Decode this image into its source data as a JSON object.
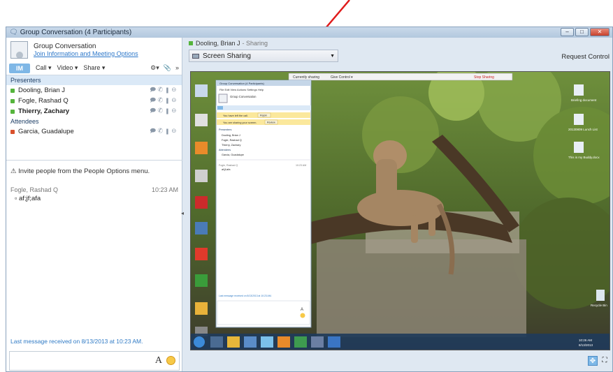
{
  "window": {
    "title": "Group Conversation (4 Participants)",
    "title_icon": "group-chat-icon"
  },
  "conversation": {
    "title": "Group Conversation",
    "join_link": "Join Information and Meeting Options"
  },
  "modebar": {
    "im": "IM",
    "call": "Call ▾",
    "video": "Video ▾",
    "share": "Share ▾"
  },
  "roster": {
    "presenters_heading": "Presenters",
    "presenters": [
      {
        "name": "Dooling, Brian J",
        "status_color": "#55b43c"
      },
      {
        "name": "Fogle, Rashad Q",
        "status_color": "#55b43c"
      },
      {
        "name": "Thierry, Zachary",
        "status_color": "#55b43c"
      }
    ],
    "attendees_heading": "Attendees",
    "attendees": [
      {
        "name": "Garcia, Guadalupe",
        "status_color": "#d9502c"
      }
    ]
  },
  "chat": {
    "invite_text": "Invite people from the People Options menu.",
    "messages": [
      {
        "sender": "Fogle, Rashad Q",
        "time": "10:23 AM",
        "text": "af;jf;afa"
      }
    ],
    "last_message_notice": "Last message received on 8/13/2013 at 10:23 AM.",
    "format_label": "A"
  },
  "sharing": {
    "presenter_line": "Dooling, Brian J",
    "presenter_suffix": "- Sharing",
    "dropdown_value": "Screen Sharing",
    "request_control": "Request Control"
  },
  "shared_desktop": {
    "toolbar_currently": "Currently sharing",
    "toolbar_give_control": "Give Control ▾",
    "toolbar_stop": "Stop Sharing",
    "mini_window_title": "Group Conversation (4 Participants)",
    "mini_menu": [
      "File",
      "Edit",
      "View",
      "Actions",
      "Settings",
      "Help"
    ],
    "mini_notice_left": "You have left the call.",
    "mini_notice_left_button": "Rejoin",
    "mini_notice_share": "You are sharing your screen.",
    "mini_notice_share_button": "Review",
    "mini_presenters": "Presenters",
    "mini_names": [
      "Dooling, Brian J",
      "Fogle, Rashad Q",
      "Thierry, Zachary"
    ],
    "mini_attendees": "Attendees",
    "mini_attendee": "Garcia, Guadalupe",
    "mini_msg_sender": "Fogle, Rashad Q",
    "mini_msg_time": "10:23 AM",
    "mini_msg_text": "af;jf;afa",
    "mini_last_msg": "Last message received on 8/13/2013 at 10:23 AM.",
    "clock_time": "10:26 AM",
    "clock_date": "8/13/2013",
    "desktop_icons_right": [
      "Briefing document",
      "20130809 Lunch List",
      "This is my Buddy.docx",
      "Recycle Bin"
    ]
  }
}
